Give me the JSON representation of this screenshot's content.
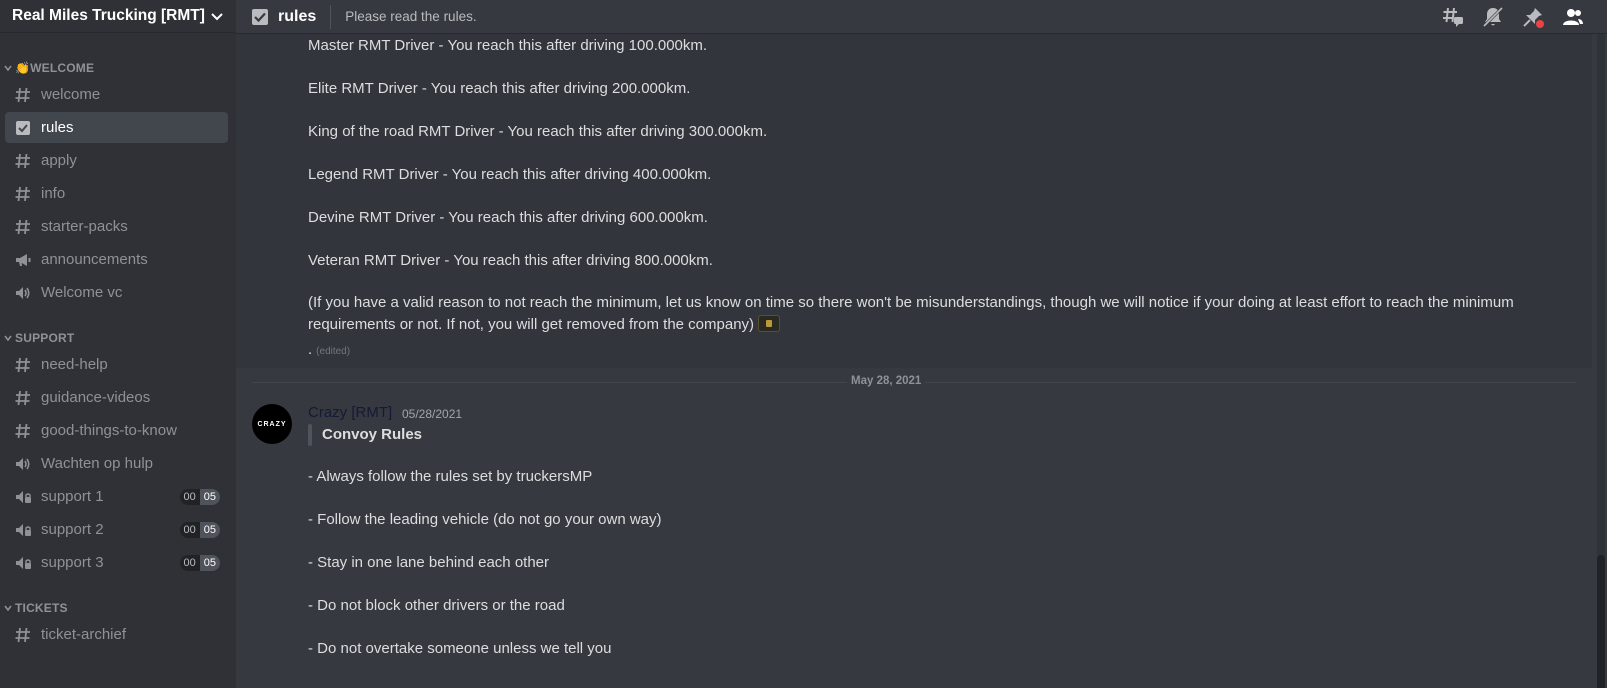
{
  "server": {
    "name": "Real Miles Trucking [RMT]"
  },
  "categories": [
    {
      "label": "👏WELCOME",
      "channels": [
        {
          "name": "welcome",
          "icon": "hash-icon"
        },
        {
          "name": "rules",
          "icon": "rules-checkbox-icon",
          "active": true
        },
        {
          "name": "apply",
          "icon": "hash-icon"
        },
        {
          "name": "info",
          "icon": "hash-icon"
        },
        {
          "name": "starter-packs",
          "icon": "hash-icon"
        },
        {
          "name": "announcements",
          "icon": "megaphone-icon"
        },
        {
          "name": "Welcome vc",
          "icon": "speaker-icon"
        }
      ]
    },
    {
      "label": "SUPPORT",
      "channels": [
        {
          "name": "need-help",
          "icon": "hash-icon"
        },
        {
          "name": "guidance-videos",
          "icon": "hash-icon"
        },
        {
          "name": "good-things-to-know",
          "icon": "hash-icon"
        },
        {
          "name": "Wachten op hulp",
          "icon": "speaker-icon"
        },
        {
          "name": "support 1",
          "icon": "speaker-lock-icon",
          "user_count": "00",
          "user_limit": "05"
        },
        {
          "name": "support 2",
          "icon": "speaker-lock-icon",
          "user_count": "00",
          "user_limit": "05"
        },
        {
          "name": "support 3",
          "icon": "speaker-lock-icon",
          "user_count": "00",
          "user_limit": "05"
        }
      ]
    },
    {
      "label": "TICKETS",
      "channels": [
        {
          "name": "ticket-archief",
          "icon": "hash-icon"
        }
      ]
    }
  ],
  "topbar": {
    "channel_name": "rules",
    "topic": "Please read the rules.",
    "tools": [
      "threads-icon",
      "mute-notifications-icon",
      "pinned-messages-icon",
      "member-list-icon"
    ]
  },
  "messages": {
    "lines": [
      "Master RMT Driver - You reach this after driving 100.000km.",
      "Elite RMT Driver - You reach this after driving 200.000km.",
      "King of the road RMT Driver - You reach this after driving 300.000km.",
      "Legend RMT Driver - You reach this after driving 400.000km.",
      "Devine RMT Driver - You reach this after driving 600.000km.",
      "Veteran RMT Driver - You reach this after driving 800.000km."
    ],
    "note": "(If you have a valid reason to not reach the minimum, let us know on time so there won't be misunderstandings, though we will notice if your doing at least effort to reach the minimum requirements or not. If not, you will get removed from the company)",
    "dot": ".",
    "edited": "(edited)",
    "date_divider": "May 28, 2021",
    "second": {
      "avatar_text": "CRAZY",
      "author": "Crazy [RMT]",
      "timestamp": "05/28/2021",
      "quote": "Convoy Rules",
      "rules": [
        "- Always follow the rules set by truckersMP",
        "- Follow the leading vehicle (do not go your own way)",
        "- Stay in one lane behind each other",
        "- Do not block other drivers or the road",
        "- Do not overtake someone unless we tell you"
      ]
    }
  }
}
